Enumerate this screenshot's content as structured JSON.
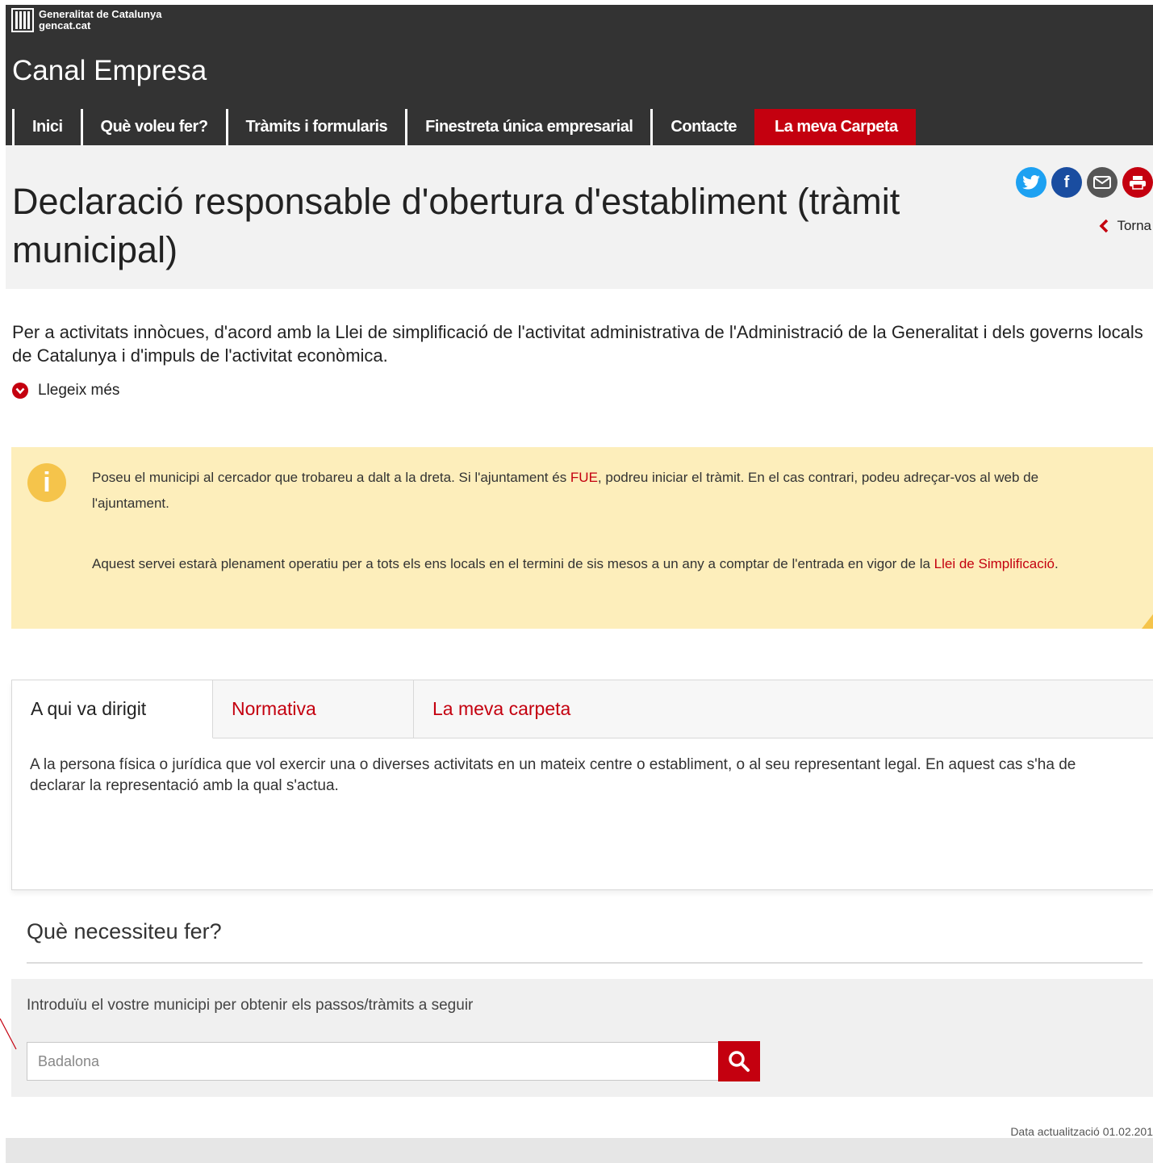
{
  "header": {
    "gen_line1": "Generalitat de Catalunya",
    "gen_line2": "gencat.cat",
    "site_title": "Canal Empresa",
    "nav": [
      {
        "label": "Inici"
      },
      {
        "label": "Què voleu fer?"
      },
      {
        "label": "Tràmits i formularis"
      },
      {
        "label": "Finestreta única empresarial"
      },
      {
        "label": "Contacte"
      },
      {
        "label": "La meva Carpeta"
      }
    ]
  },
  "page": {
    "title": "Declaració responsable d'obertura d'establiment (tràmit municipal)",
    "back_label": "Torna"
  },
  "intro": {
    "text": "Per a activitats innòcues, d'acord amb la Llei de simplificació de l'activitat administrativa de l'Administració de la Generalitat i dels governs locals de Catalunya i d'impuls de l'activitat econòmica.",
    "read_more": "Llegeix més"
  },
  "info": {
    "p1_before": "Poseu el municipi al cercador que trobareu a dalt a la dreta. Si l'ajuntament és ",
    "p1_link": "FUE",
    "p1_after": ", podreu iniciar el tràmit. En el cas contrari, podeu adreçar-vos al web de l'ajuntament.",
    "p2_before": "Aquest servei estarà plenament operatiu per a tots els ens locals en el termini de sis mesos a un any a comptar de l'entrada en vigor de la ",
    "p2_link": "Llei de Simplificació",
    "p2_after": "."
  },
  "tabs": {
    "items": [
      {
        "label": "A qui va dirigit"
      },
      {
        "label": "Normativa"
      },
      {
        "label": "La meva carpeta"
      }
    ],
    "content": "A la persona física o jurídica que vol exercir una o diverses activitats en un mateix centre o establiment, o al seu representant legal. En aquest cas s'ha de declarar la representació amb la qual s'actua."
  },
  "need": {
    "title": "Què necessiteu fer?",
    "label": "Introduïu el vostre municipi per obtenir els passos/tràmits a seguir",
    "input_value": "Badalona"
  },
  "footer": {
    "updated": "Data actualització 01.02.201"
  },
  "colors": {
    "brand_red": "#c4000f",
    "header_dark": "#333333",
    "info_bg": "#fdeebb"
  }
}
